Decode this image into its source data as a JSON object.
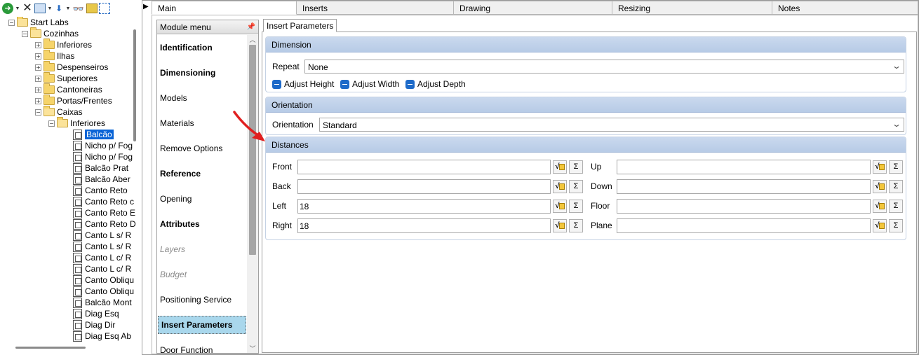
{
  "toolbar": {
    "icons": [
      "go-icon",
      "dropdown-icon",
      "delete-icon",
      "copy-icon",
      "dropdown-icon",
      "move-down-icon",
      "dropdown-icon",
      "find-icon",
      "refresh-icon",
      "group-icon"
    ]
  },
  "tree": {
    "nodes": [
      {
        "label": "Start Labs",
        "level": 0,
        "type": "folder",
        "expander": "−"
      },
      {
        "label": "Cozinhas",
        "level": 1,
        "type": "folder",
        "expander": "−"
      },
      {
        "label": "Inferiores",
        "level": 2,
        "type": "folder",
        "expander": "+"
      },
      {
        "label": "Ilhas",
        "level": 2,
        "type": "folder",
        "expander": "+"
      },
      {
        "label": "Despenseiros",
        "level": 2,
        "type": "folder",
        "expander": "+"
      },
      {
        "label": "Superiores",
        "level": 2,
        "type": "folder",
        "expander": "+"
      },
      {
        "label": "Cantoneiras",
        "level": 2,
        "type": "folder",
        "expander": "+"
      },
      {
        "label": "Portas/Frentes",
        "level": 2,
        "type": "folder",
        "expander": "+"
      },
      {
        "label": "Caixas",
        "level": 2,
        "type": "folder",
        "expander": "−"
      },
      {
        "label": "Inferiores",
        "level": 3,
        "type": "folder",
        "expander": "−"
      },
      {
        "label": "Balcão",
        "level": 4,
        "type": "doc",
        "selected": true
      },
      {
        "label": "Nicho p/ Fog",
        "level": 4,
        "type": "doc"
      },
      {
        "label": "Nicho p/ Fog",
        "level": 4,
        "type": "doc"
      },
      {
        "label": "Balcão Prat",
        "level": 4,
        "type": "doc"
      },
      {
        "label": "Balcão Aber",
        "level": 4,
        "type": "doc"
      },
      {
        "label": "Canto Reto",
        "level": 4,
        "type": "doc"
      },
      {
        "label": "Canto Reto c",
        "level": 4,
        "type": "doc"
      },
      {
        "label": "Canto Reto E",
        "level": 4,
        "type": "doc"
      },
      {
        "label": "Canto Reto D",
        "level": 4,
        "type": "doc"
      },
      {
        "label": "Canto L s/ R",
        "level": 4,
        "type": "doc"
      },
      {
        "label": "Canto L s/ R",
        "level": 4,
        "type": "doc"
      },
      {
        "label": "Canto L c/ R",
        "level": 4,
        "type": "doc"
      },
      {
        "label": "Canto L c/ R",
        "level": 4,
        "type": "doc"
      },
      {
        "label": "Canto Obliqu",
        "level": 4,
        "type": "doc"
      },
      {
        "label": "Canto Obliqu",
        "level": 4,
        "type": "doc"
      },
      {
        "label": "Balcão Mont",
        "level": 4,
        "type": "doc"
      },
      {
        "label": "Diag Esq",
        "level": 4,
        "type": "doc"
      },
      {
        "label": "Diag Dir",
        "level": 4,
        "type": "doc"
      },
      {
        "label": "Diag Esq Ab",
        "level": 4,
        "type": "doc"
      }
    ]
  },
  "tabs": [
    "Main",
    "Inserts",
    "Drawing",
    "Resizing",
    "Notes"
  ],
  "module_menu": {
    "title": "Module menu",
    "items": [
      {
        "label": "Identification",
        "style": "bold"
      },
      {
        "label": "Dimensioning",
        "style": "bold"
      },
      {
        "label": "Models",
        "style": "normal"
      },
      {
        "label": "Materials",
        "style": "normal"
      },
      {
        "label": "Remove Options",
        "style": "normal"
      },
      {
        "label": "Reference",
        "style": "bold"
      },
      {
        "label": "Opening",
        "style": "normal"
      },
      {
        "label": "Attributes",
        "style": "bold"
      },
      {
        "label": "Layers",
        "style": "disabled"
      },
      {
        "label": "Budget",
        "style": "disabled"
      },
      {
        "label": "Positioning Service",
        "style": "normal"
      },
      {
        "label": "Insert Parameters",
        "style": "selected"
      },
      {
        "label": "Door Function",
        "style": "normal"
      }
    ]
  },
  "insert_parameters": {
    "tab_label": "Insert Parameters",
    "dimension": {
      "title": "Dimension",
      "repeat_label": "Repeat",
      "repeat_value": "None",
      "checks": [
        "Adjust Height",
        "Adjust Width",
        "Adjust Depth"
      ]
    },
    "orientation": {
      "title": "Orientation",
      "label": "Orientation",
      "value": "Standard"
    },
    "distances": {
      "title": "Distances",
      "left_fields": [
        {
          "label": "Front",
          "value": ""
        },
        {
          "label": "Back",
          "value": ""
        },
        {
          "label": "Left",
          "value": "18"
        },
        {
          "label": "Right",
          "value": "18"
        }
      ],
      "right_fields": [
        {
          "label": "Up",
          "value": ""
        },
        {
          "label": "Down",
          "value": ""
        },
        {
          "label": "Floor",
          "value": ""
        },
        {
          "label": "Plane",
          "value": ""
        }
      ],
      "sum_symbol": "Σ"
    }
  },
  "colors": {
    "selection": "#0a64d6",
    "group_header": "#b7cbe6",
    "menu_selected": "#a9d7ec",
    "checkbox": "#1d6ac9",
    "annotation_arrow": "#e02020"
  }
}
